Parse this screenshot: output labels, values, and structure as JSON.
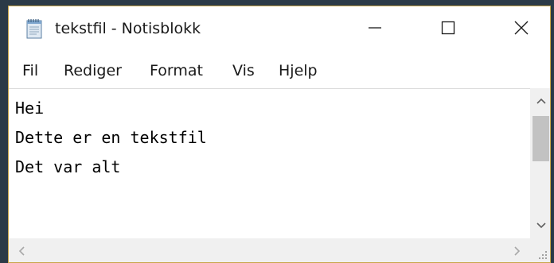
{
  "window": {
    "title": "tekstfil - Notisblokk",
    "icon": "notepad-icon",
    "controls": {
      "minimize_icon": "minimize-icon",
      "maximize_icon": "maximize-icon",
      "close_icon": "close-icon"
    },
    "border_color": "#c9a64a"
  },
  "menu": {
    "items": [
      {
        "label": "Fil"
      },
      {
        "label": "Rediger"
      },
      {
        "label": "Format"
      },
      {
        "label": "Vis"
      },
      {
        "label": "Hjelp"
      }
    ]
  },
  "editor": {
    "lines": [
      "Hei",
      "Dette er en tekstfil",
      "Det var alt"
    ]
  },
  "scrollbars": {
    "vertical_up_icon": "chevron-up-icon",
    "vertical_down_icon": "chevron-down-icon",
    "horizontal_left_icon": "chevron-left-icon",
    "horizontal_right_icon": "chevron-right-icon",
    "resize_grip_icon": "resize-grip-icon"
  }
}
